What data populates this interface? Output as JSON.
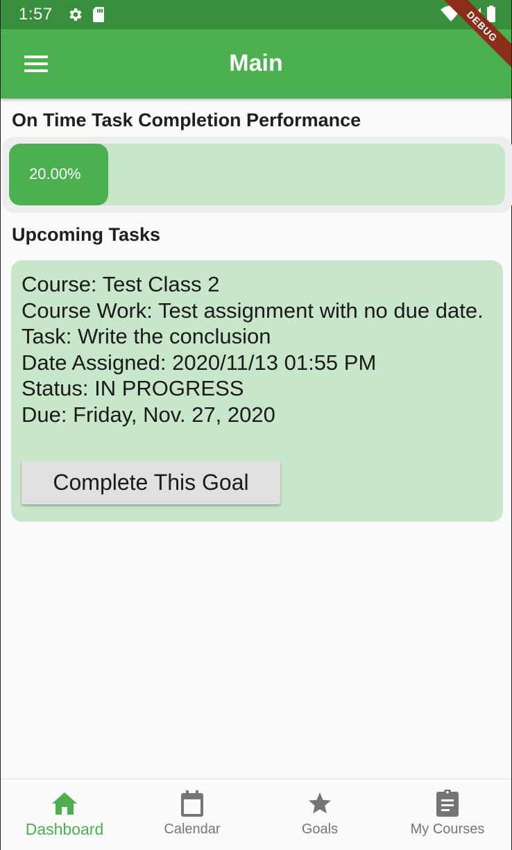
{
  "status_bar": {
    "time": "1:57",
    "icons": [
      "gear-icon",
      "sd-card-icon",
      "wifi-icon",
      "signal-icon",
      "battery-icon"
    ]
  },
  "debug_banner": "DEBUG",
  "app_bar": {
    "title": "Main",
    "menu_icon": "menu-icon",
    "color": "#4caf50"
  },
  "performance": {
    "title": "On Time Task Completion Performance",
    "percent_label": "20.00%",
    "percent_value": 0.2
  },
  "upcoming": {
    "title": "Upcoming Tasks",
    "tasks": [
      {
        "course": "Course: Test Class 2",
        "course_work": "Course Work: Test assignment with no due date.",
        "task": "Task: Write the conclusion",
        "date_assigned": "Date Assigned: 2020/11/13 01:55 PM",
        "status": "Status: IN PROGRESS",
        "due": "Due: Friday, Nov. 27, 2020",
        "button_label": "Complete This Goal"
      }
    ]
  },
  "bottom_nav": {
    "active_color": "#4caf50",
    "inactive_color": "#757575",
    "items": [
      {
        "label": "Dashboard",
        "icon": "home-icon",
        "active": true
      },
      {
        "label": "Calendar",
        "icon": "calendar-icon",
        "active": false
      },
      {
        "label": "Goals",
        "icon": "star-icon",
        "active": false
      },
      {
        "label": "My Courses",
        "icon": "clipboard-icon",
        "active": false
      }
    ]
  }
}
